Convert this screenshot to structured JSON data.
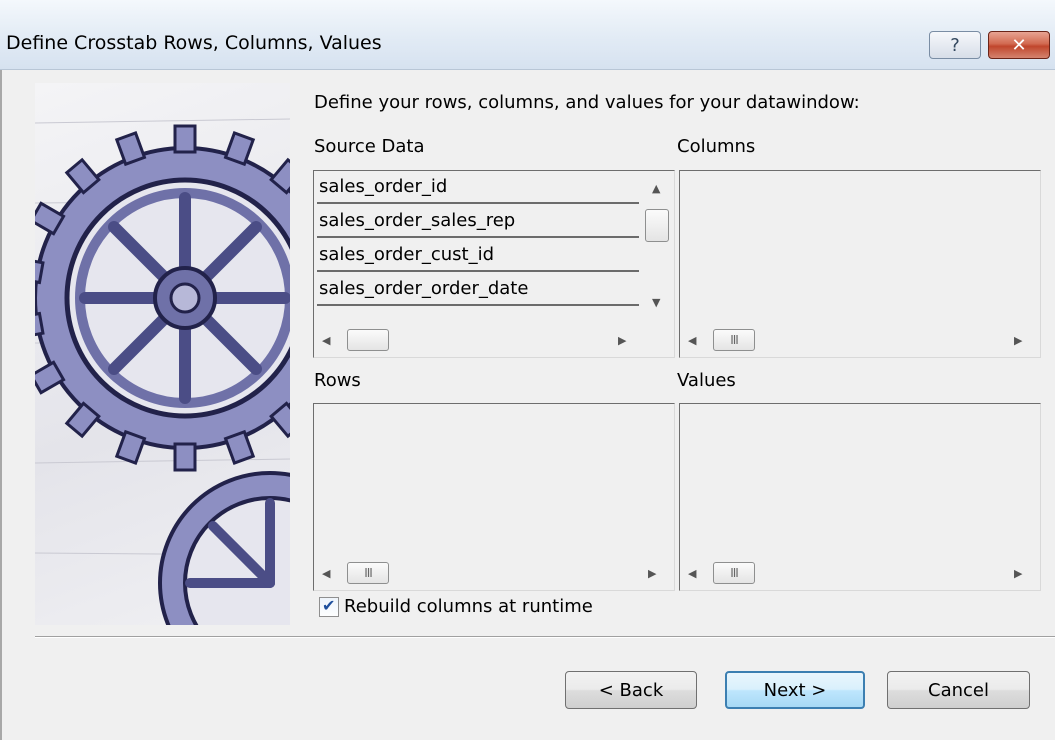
{
  "window": {
    "title": "Define Crosstab Rows, Columns, Values",
    "help_glyph": "?",
    "close_glyph": "✕"
  },
  "intro": "Define your rows, columns, and values for your datawindow:",
  "source_data": {
    "label": "Source Data",
    "items": [
      "sales_order_id",
      "sales_order_sales_rep",
      "sales_order_cust_id",
      "sales_order_order_date"
    ]
  },
  "columns": {
    "label": "Columns"
  },
  "rows": {
    "label": "Rows"
  },
  "values": {
    "label": "Values"
  },
  "scroll": {
    "up": "▲",
    "down": "▼",
    "left": "◀",
    "right": "▶",
    "grip": "III"
  },
  "rebuild": {
    "label": "Rebuild columns at runtime",
    "checked": true,
    "check_glyph": "✔"
  },
  "buttons": {
    "back": "< Back",
    "next": "Next >",
    "cancel": "Cancel"
  },
  "colors": {
    "accent": "#3c7fb1",
    "close_red": "#c0462c",
    "gear_ink": "#3e3e72"
  }
}
